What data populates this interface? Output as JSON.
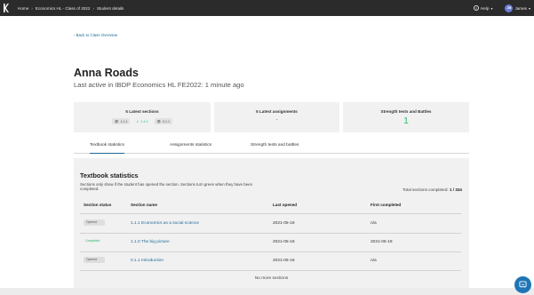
{
  "topbar": {
    "breadcrumbs": [
      "Home",
      "Economics HL - Class of 2022",
      "Student details"
    ],
    "help_label": "Help",
    "user_initials": "JM",
    "user_name": "James"
  },
  "back_link": "‹ Back to Class Overview",
  "student": {
    "name": "Anna Roads",
    "last_active": "Last active in IBDP Economics HL FE2022: 1 minute ago"
  },
  "cards": {
    "sections": {
      "title": "5 Latest sections",
      "chips": [
        {
          "icon": "eye-icon",
          "label": "1.1.1"
        },
        {
          "icon": "check-icon",
          "label": "1.1.0"
        },
        {
          "icon": "eye-icon",
          "label": "0.1.1"
        }
      ]
    },
    "assignments": {
      "title": "5 Latest assignments",
      "value": "-"
    },
    "strength": {
      "title": "Strength tests and Battles",
      "value": "1"
    }
  },
  "tabs": [
    {
      "label": "Textbook statistics",
      "active": true
    },
    {
      "label": "Assignments statistics",
      "active": false
    },
    {
      "label": "Strength tests and battles",
      "active": false
    }
  ],
  "textbook": {
    "heading": "Textbook statistics",
    "description": "Sections only show if the student has opened the section. Sections turn green when they have been completed.",
    "total_label": "Total sections completed:",
    "total_value": "1 / 334",
    "columns": [
      "Section status",
      "Section name",
      "Last opened",
      "First completed"
    ],
    "rows": [
      {
        "status": "Opened",
        "section": "1.1.1 Economics as a social science",
        "last_opened": "2021-05-18",
        "first_completed": "n/a"
      },
      {
        "status": "Completed",
        "section": "1.1.0 The big picture",
        "last_opened": "2021-05-18",
        "first_completed": "2021-05-18"
      },
      {
        "status": "Opened",
        "section": "0.1.1 Introduction",
        "last_opened": "2021-05-18",
        "first_completed": "n/a"
      }
    ],
    "no_more": "No more sections"
  },
  "colors": {
    "accent": "#1e6a98",
    "success": "#2db56c",
    "topbar": "#2b2b2b",
    "chat": "#1e75b5"
  }
}
